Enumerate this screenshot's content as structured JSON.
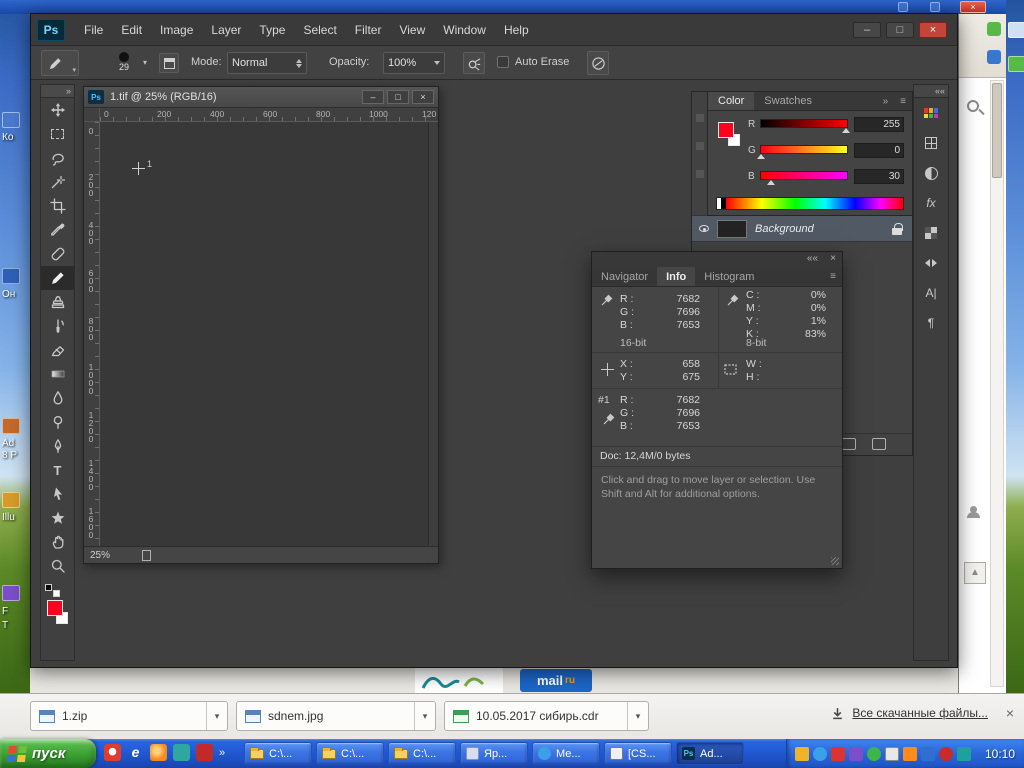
{
  "icons": {
    "collapse_right": "»",
    "collapse_left": "««",
    "close": "×",
    "minimize": "–",
    "maximize": "□",
    "chevron_down": "▾",
    "panel_menu": "≡",
    "fx": "fx",
    "character_panel": "A|",
    "paragraph_panel": "¶",
    "up_arrow": "▲",
    "type_tool": "T",
    "ie": "e"
  },
  "photoshop": {
    "logo": "Ps",
    "menu": [
      "File",
      "Edit",
      "Image",
      "Layer",
      "Type",
      "Select",
      "Filter",
      "View",
      "Window",
      "Help"
    ],
    "options_bar": {
      "brush_size": "29",
      "mode_label": "Mode:",
      "mode_value": "Normal",
      "opacity_label": "Opacity:",
      "opacity_value": "100%",
      "auto_erase_label": "Auto Erase"
    },
    "document": {
      "title": "1.tif @ 25% (RGB/16)",
      "zoom_status": "25%",
      "h_ruler": [
        "0",
        "200",
        "400",
        "600",
        "800",
        "1000",
        "120"
      ],
      "v_ruler": [
        "0",
        "200",
        "400",
        "600",
        "800",
        "1000",
        "1200",
        "1400",
        "1600"
      ],
      "cursor_label": "1"
    },
    "color_panel": {
      "tabs": [
        "Color",
        "Swatches"
      ],
      "channels": [
        {
          "label": "R",
          "value": "255"
        },
        {
          "label": "G",
          "value": "0"
        },
        {
          "label": "B",
          "value": "30"
        }
      ]
    },
    "layers_panel": {
      "layer_name": "Background"
    },
    "info_panel": {
      "tabs": [
        "Navigator",
        "Info",
        "Histogram"
      ],
      "rgb_rows": [
        {
          "label": "R :",
          "value": "7682"
        },
        {
          "label": "G :",
          "value": "7696"
        },
        {
          "label": "B :",
          "value": "7653"
        }
      ],
      "rgb_depth": "16-bit",
      "cmyk_rows": [
        {
          "label": "C :",
          "value": "0%"
        },
        {
          "label": "M :",
          "value": "0%"
        },
        {
          "label": "Y :",
          "value": "1%"
        },
        {
          "label": "K :",
          "value": "83%"
        }
      ],
      "cmyk_depth": "8-bit",
      "pos_rows": [
        {
          "label": "X :",
          "value": "658"
        },
        {
          "label": "Y :",
          "value": "675"
        }
      ],
      "size_rows": [
        {
          "label": "W :",
          "value": ""
        },
        {
          "label": "H :",
          "value": ""
        }
      ],
      "sample_id": "#1",
      "sample_rows": [
        {
          "label": "R :",
          "value": "7682"
        },
        {
          "label": "G :",
          "value": "7696"
        },
        {
          "label": "B :",
          "value": "7653"
        }
      ],
      "doc_size": "Doc: 12,4M/0 bytes",
      "hint": "Click and drag to move layer or selection.  Use Shift and Alt for additional options."
    }
  },
  "page_fragment": {
    "mail_label": "mail",
    "mail_suffix": "ru"
  },
  "download_bar": {
    "items": [
      {
        "label": "1.zip"
      },
      {
        "label": "sdnem.jpg"
      },
      {
        "label": "10.05.2017 сибирь.cdr"
      }
    ],
    "show_all_label": "Все скачанные файлы..."
  },
  "taskbar": {
    "start_label": "пуск",
    "tasks": [
      {
        "label": "C:\\..."
      },
      {
        "label": "C:\\..."
      },
      {
        "label": "C:\\..."
      },
      {
        "label": "Яр..."
      },
      {
        "label": "Ме..."
      },
      {
        "label": "[CS..."
      },
      {
        "label": "Ad..."
      }
    ],
    "clock": "10:10"
  },
  "desktop": {
    "icon_labels": [
      "Ко",
      "Он",
      "Ad",
      "8 P",
      "Illu",
      "F",
      "T"
    ]
  }
}
